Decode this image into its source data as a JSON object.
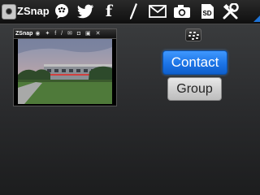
{
  "app": {
    "title": "ZSnap"
  },
  "toolbar": {
    "items": [
      {
        "name": "bbm-icon",
        "interactable": true
      },
      {
        "name": "twitter-icon",
        "interactable": true
      },
      {
        "name": "facebook-icon",
        "label": "f",
        "interactable": true
      },
      {
        "name": "pen-icon",
        "interactable": true
      },
      {
        "name": "email-icon",
        "interactable": true
      },
      {
        "name": "camera-icon",
        "interactable": true
      },
      {
        "name": "sd-card-icon",
        "label": "SD",
        "interactable": true
      },
      {
        "name": "tools-icon",
        "interactable": true
      }
    ]
  },
  "preview": {
    "mini_title": "ZSnap",
    "mini_icons": "◉ ✦ f / ✉ ◘ ▣ ✕",
    "photo_subject": "building-photo"
  },
  "share": {
    "contact_label": "Contact",
    "group_label": "Group",
    "blackberry_icon": "blackberry-logo-icon"
  },
  "colors": {
    "accent": "#1c74e6",
    "toolbar_bg": "#111111",
    "body_bg": "#2e2f31"
  }
}
